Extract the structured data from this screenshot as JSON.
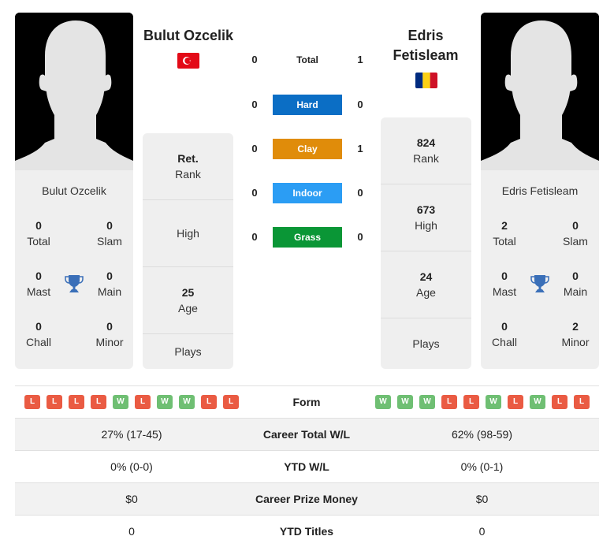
{
  "player1": {
    "name": "Bulut Ozcelik",
    "flag": "turkey-flag",
    "card_name": "Bulut Ozcelik",
    "titles": {
      "total": {
        "value": "0",
        "label": "Total"
      },
      "slam": {
        "value": "0",
        "label": "Slam"
      },
      "mast": {
        "value": "0",
        "label": "Mast"
      },
      "main": {
        "value": "0",
        "label": "Main"
      },
      "chall": {
        "value": "0",
        "label": "Chall"
      },
      "minor": {
        "value": "0",
        "label": "Minor"
      }
    },
    "info": {
      "rank": {
        "value": "Ret.",
        "label": "Rank"
      },
      "high": {
        "value": "",
        "label": "High"
      },
      "age": {
        "value": "25",
        "label": "Age"
      },
      "plays": {
        "value": "",
        "label": "Plays"
      }
    },
    "form": [
      "L",
      "L",
      "L",
      "L",
      "W",
      "L",
      "W",
      "W",
      "L",
      "L"
    ]
  },
  "player2": {
    "name": "Edris Fetisleam",
    "flag": "romania-flag",
    "card_name": "Edris Fetisleam",
    "titles": {
      "total": {
        "value": "2",
        "label": "Total"
      },
      "slam": {
        "value": "0",
        "label": "Slam"
      },
      "mast": {
        "value": "0",
        "label": "Mast"
      },
      "main": {
        "value": "0",
        "label": "Main"
      },
      "chall": {
        "value": "0",
        "label": "Chall"
      },
      "minor": {
        "value": "2",
        "label": "Minor"
      }
    },
    "info": {
      "rank": {
        "value": "824",
        "label": "Rank"
      },
      "high": {
        "value": "673",
        "label": "High"
      },
      "age": {
        "value": "24",
        "label": "Age"
      },
      "plays": {
        "value": "",
        "label": "Plays"
      }
    },
    "form": [
      "W",
      "W",
      "W",
      "L",
      "L",
      "W",
      "L",
      "W",
      "L",
      "L"
    ]
  },
  "h2h": [
    {
      "label": "Total",
      "p1": "0",
      "p2": "1",
      "color": ""
    },
    {
      "label": "Hard",
      "p1": "0",
      "p2": "0",
      "color": "#0b6ec5"
    },
    {
      "label": "Clay",
      "p1": "0",
      "p2": "1",
      "color": "#e08c0a"
    },
    {
      "label": "Indoor",
      "p1": "0",
      "p2": "0",
      "color": "#2b9df4"
    },
    {
      "label": "Grass",
      "p1": "0",
      "p2": "0",
      "color": "#0a9636"
    }
  ],
  "comparison": {
    "form_label": "Form",
    "rows": [
      {
        "label": "Career Total W/L",
        "p1": "27% (17-45)",
        "p2": "62% (98-59)"
      },
      {
        "label": "YTD W/L",
        "p1": "0% (0-0)",
        "p2": "0% (0-1)"
      },
      {
        "label": "Career Prize Money",
        "p1": "$0",
        "p2": "$0"
      },
      {
        "label": "YTD Titles",
        "p1": "0",
        "p2": "0"
      }
    ]
  },
  "colors": {
    "win": "#6fbf73",
    "loss": "#ea5b43",
    "trophy": "#3a6fb8"
  }
}
